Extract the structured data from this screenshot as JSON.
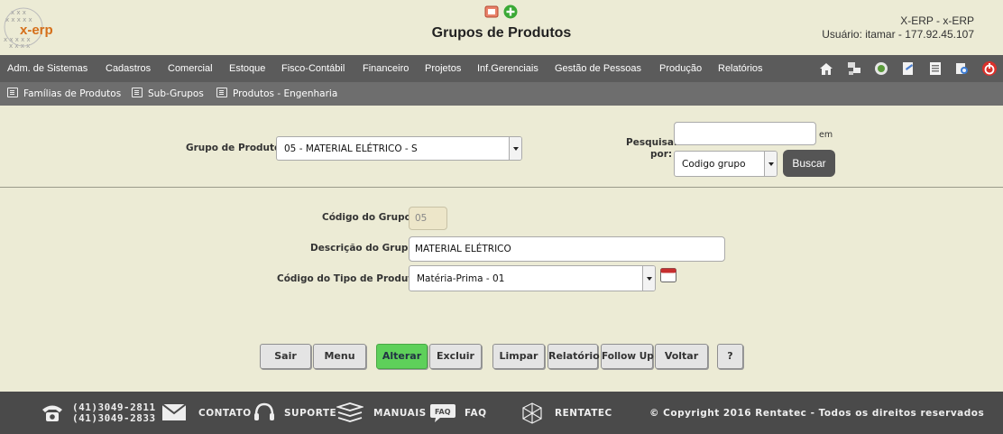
{
  "header": {
    "logo_text": "x-erp",
    "title": "Grupos de Produtos",
    "system_name": "X-ERP - x-ERP",
    "user_info": "Usuário: itamar - 177.92.45.107"
  },
  "menu": {
    "items": [
      "Adm. de Sistemas",
      "Cadastros",
      "Comercial",
      "Estoque",
      "Fisco-Contábil",
      "Financeiro",
      "Projetos",
      "Inf.Gerenciais",
      "Gestão de Pessoas",
      "Produção",
      "Relatórios"
    ]
  },
  "submenu": {
    "items": [
      "Famílias de Produtos",
      "Sub-Grupos",
      "Produtos - Engenharia"
    ]
  },
  "search": {
    "group_label": "Grupo de Produtos",
    "group_value": "05 - MATERIAL ELÉTRICO - S",
    "search_label_1": "Pesquisar",
    "search_label_2": "por:",
    "search_input_value": "",
    "em_label": "em",
    "search_by_value": "Codigo grupo",
    "search_button": "Buscar"
  },
  "form": {
    "code_label": "Código do Grupo",
    "code_value": "05",
    "desc_label": "Descrição do Grupo",
    "desc_value": "MATERIAL ELÉTRICO",
    "type_label": "Código do Tipo de Produto",
    "type_value": "Matéria-Prima - 01",
    "required_mark": "*"
  },
  "actions": {
    "sair": "Sair",
    "menu": "Menu",
    "alterar": "Alterar",
    "excluir": "Excluir",
    "limpar": "Limpar",
    "relatorio": "Relatório",
    "follow_up": "Follow Up",
    "voltar": "Voltar",
    "help": "?"
  },
  "footer": {
    "phone_1": "(41)3049-2811",
    "phone_2": "(41)3049-2833",
    "contato": "CONTATO",
    "suporte": "SUPORTE",
    "manuais": "MANUAIS",
    "faq": "FAQ",
    "faq_bubble": "FAQ",
    "rentatec": "RENTATEC",
    "copyright": "© Copyright 2016 Rentatec - Todos os direitos reservados"
  },
  "colors": {
    "background": "#ecebd5",
    "menubar": "#5b5b5b",
    "submenu": "#6e6e6e",
    "accent_green": "#5ed05a",
    "footer": "#4a4a4a"
  }
}
